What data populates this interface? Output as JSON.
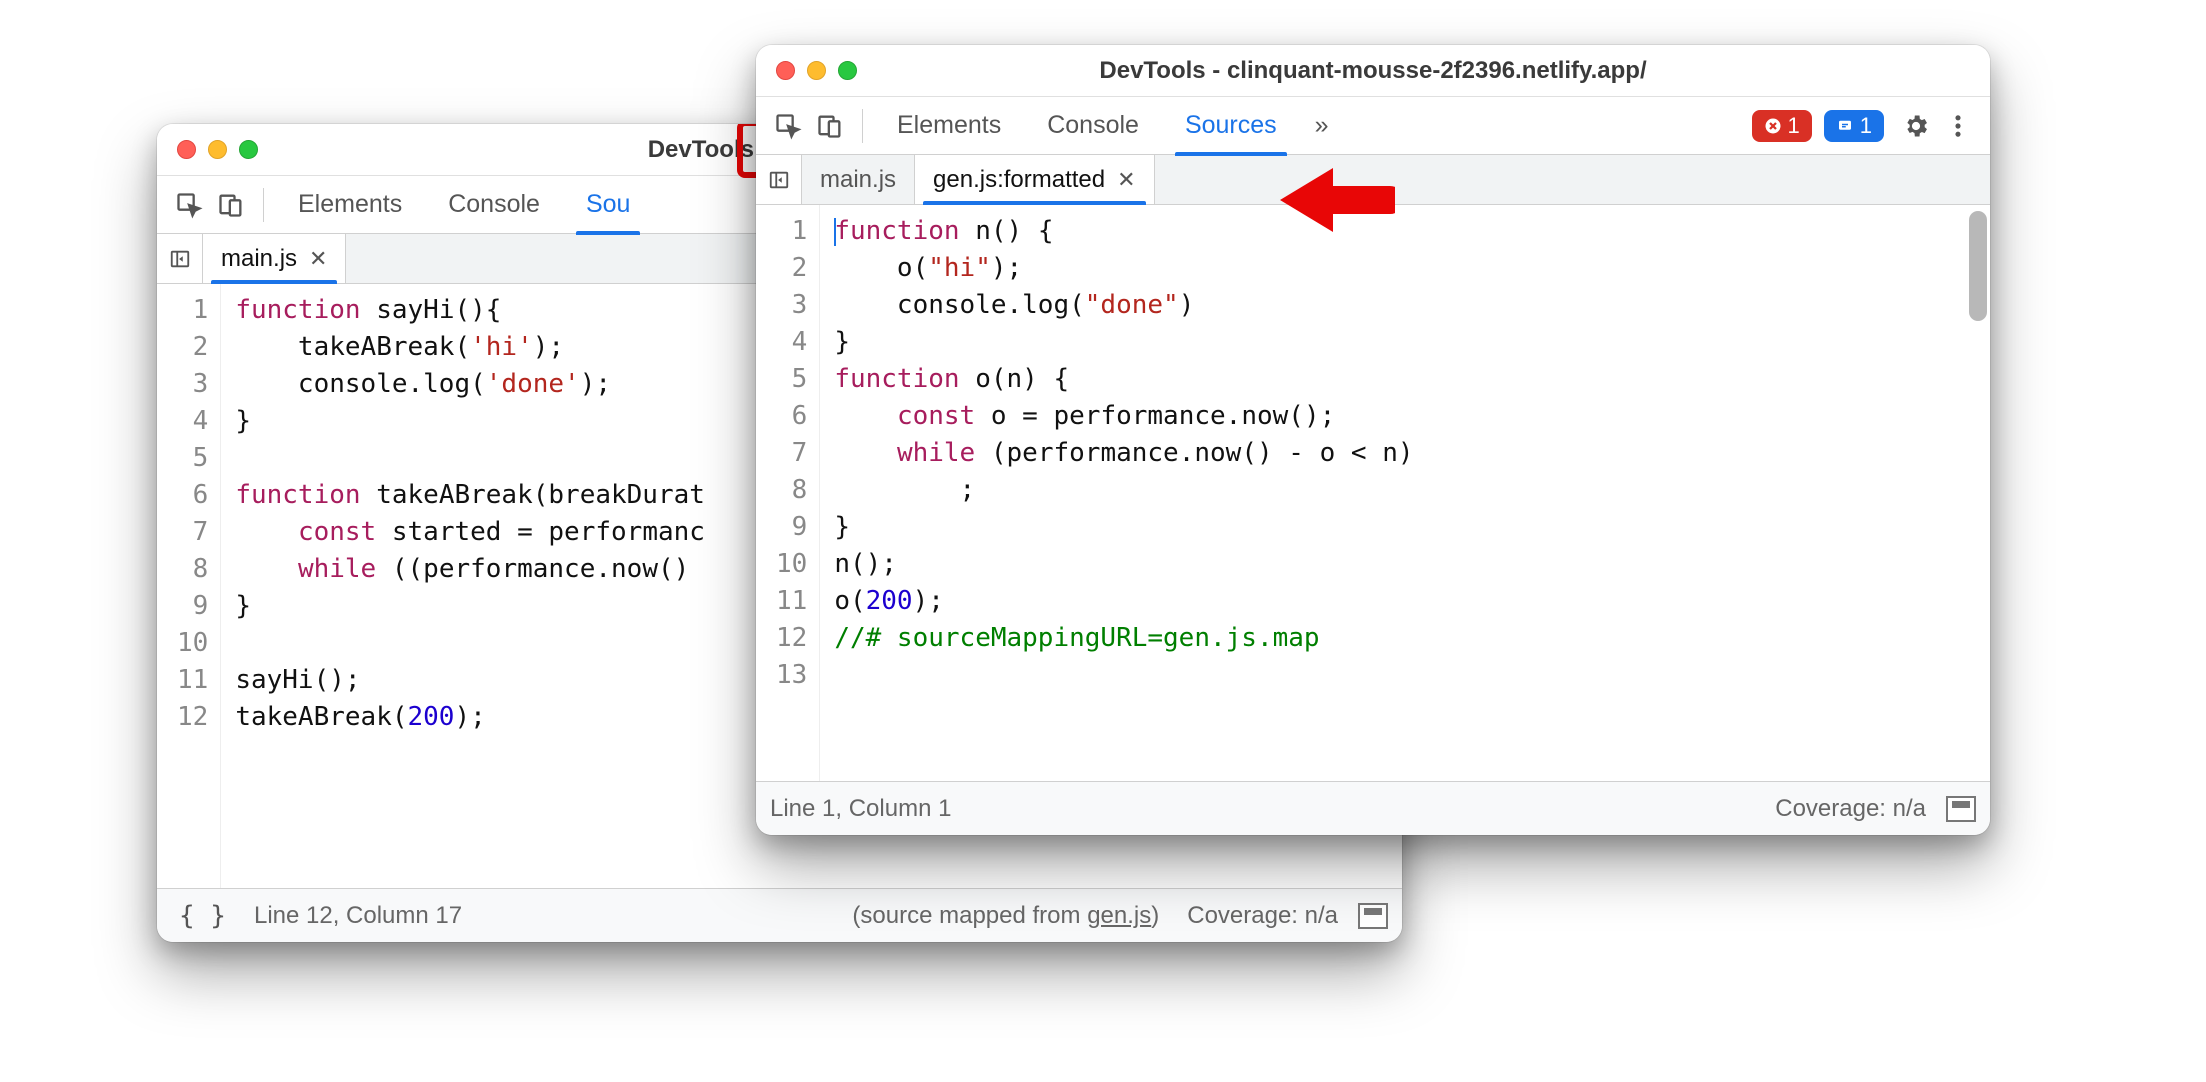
{
  "back": {
    "title": "DevTools - clinquant-m",
    "panels": [
      "Elements",
      "Console",
      "Sou"
    ],
    "activePanelIndex": 2,
    "fileTabs": [
      {
        "label": "main.js",
        "active": true
      }
    ],
    "gutter": " 1\n 2\n 3\n 4\n 5\n 6\n 7\n 8\n 9\n10\n11\n12",
    "status": {
      "lineCol": "Line 12, Column 17",
      "sourceMappedPrefix": "(source mapped from ",
      "sourceMappedFile": "gen.js",
      "sourceMappedSuffix": ")",
      "coverage": "Coverage: n/a"
    },
    "code": {
      "l1a": "function",
      "l1b": " sayHi(){",
      "l2a": "    takeABreak(",
      "l2b": "'hi'",
      "l2c": ");",
      "l3a": "    console.log(",
      "l3b": "'done'",
      "l3c": ");",
      "l4": "}",
      "l5": "",
      "l6a": "function",
      "l6b": " takeABreak(breakDurat",
      "l7a": "    ",
      "l7b": "const",
      "l7c": " started = performanc",
      "l8a": "    ",
      "l8b": "while",
      "l8c": " ((performance.now()",
      "l9": "}",
      "l10": "",
      "l11": "sayHi();",
      "l12a": "takeABreak(",
      "l12b": "200",
      "l12c": ");"
    }
  },
  "front": {
    "title": "DevTools - clinquant-mousse-2f2396.netlify.app/",
    "panels": [
      "Elements",
      "Console",
      "Sources"
    ],
    "activePanelIndex": 2,
    "moreGlyph": "»",
    "badges": {
      "errors": "1",
      "info": "1"
    },
    "fileTabs": [
      {
        "label": "main.js",
        "active": false
      },
      {
        "label": "gen.js:formatted",
        "active": true
      }
    ],
    "gutter": " 1\n 2\n 3\n 4\n 5\n 6\n 7\n 8\n 9\n10\n11\n12\n13",
    "status": {
      "lineCol": "Line 1, Column 1",
      "coverage": "Coverage: n/a"
    },
    "code": {
      "l1a": "function",
      "l1b": " n() {",
      "l2a": "    o(",
      "l2b": "\"hi\"",
      "l2c": ");",
      "l3a": "    console.log(",
      "l3b": "\"done\"",
      "l3c": ")",
      "l4": "}",
      "l5a": "function",
      "l5b": " o(n) {",
      "l6a": "    ",
      "l6b": "const",
      "l6c": " o = performance.now();",
      "l7a": "    ",
      "l7b": "while",
      "l7c": " (performance.now() - o < n)",
      "l8": "        ;",
      "l9": "}",
      "l10": "n();",
      "l11a": "o(",
      "l11b": "200",
      "l11c": ");",
      "l12": "//# sourceMappingURL=gen.js.map",
      "l13": ""
    }
  }
}
